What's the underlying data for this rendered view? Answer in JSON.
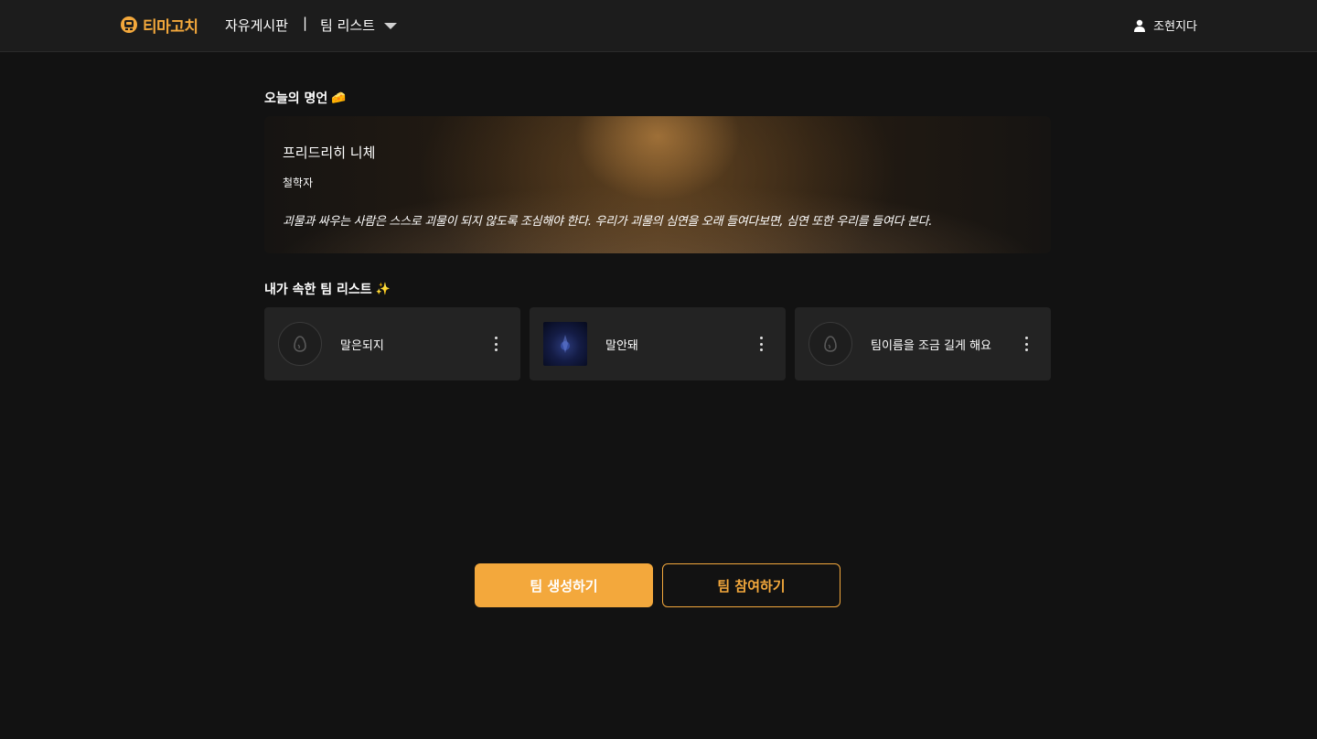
{
  "header": {
    "logo_text": "티마고치",
    "nav_board": "자유게시판",
    "nav_divider": "|",
    "nav_teams": "팀 리스트",
    "user_name": "조현지다"
  },
  "quote_section": {
    "title": "오늘의 명언",
    "emoji": "🧀",
    "author": "프리드리히 니체",
    "role": "철학자",
    "text": "괴물과 싸우는 사람은 스스로 괴물이 되지 않도록 조심해야 한다. 우리가 괴물의 심연을 오래 들여다보면, 심연 또한 우리를 들여다 본다."
  },
  "teams_section": {
    "title": "내가 속한 팀 리스트",
    "emoji": "✨",
    "teams": [
      {
        "name": "말은되지",
        "avatar": "egg-icon"
      },
      {
        "name": "말안돼",
        "avatar": "image"
      },
      {
        "name": "팀이름을 조금 길게 해요",
        "avatar": "egg-icon"
      }
    ]
  },
  "actions": {
    "create_label": "팀 생성하기",
    "join_label": "팀 참여하기"
  },
  "colors": {
    "accent": "#f3a83c",
    "background": "#121212",
    "card": "#232323"
  }
}
